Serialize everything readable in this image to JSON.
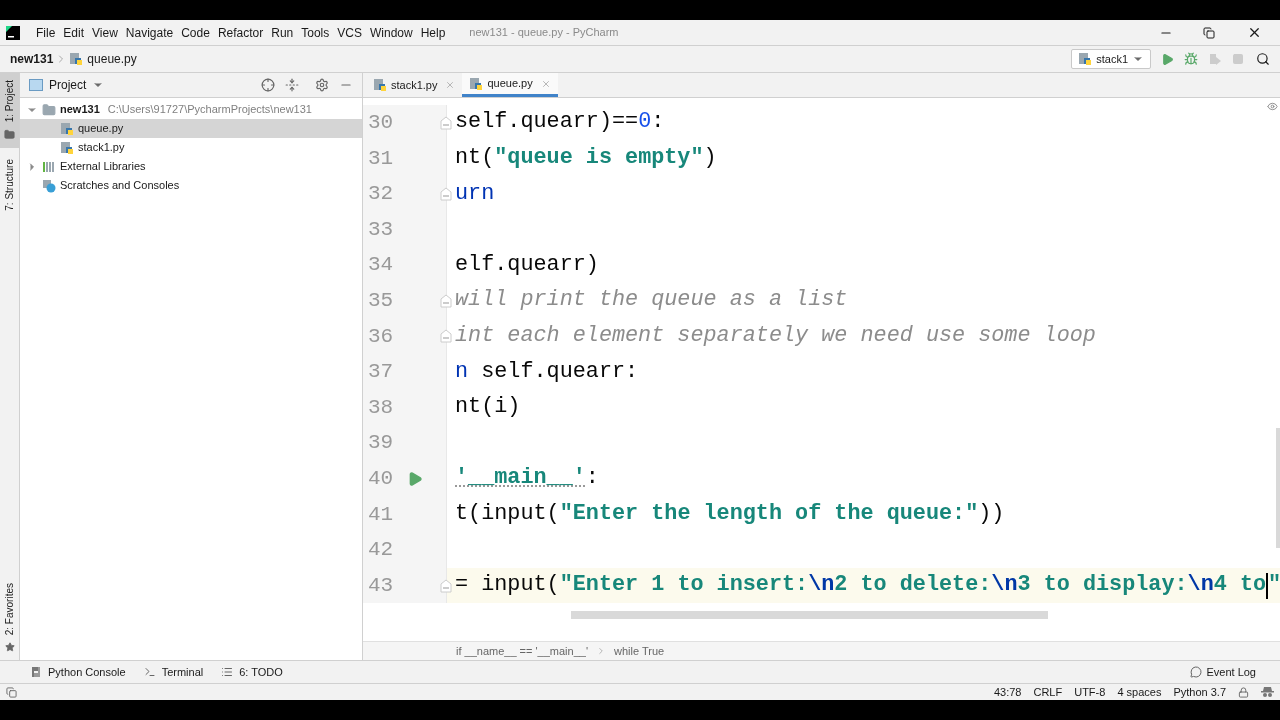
{
  "menu": {
    "items": [
      "File",
      "Edit",
      "View",
      "Navigate",
      "Code",
      "Refactor",
      "Run",
      "Tools",
      "VCS",
      "Window",
      "Help"
    ],
    "title": "new131 - queue.py - PyCharm"
  },
  "navbar": {
    "crumbs": [
      "new131",
      "queue.py"
    ],
    "run_config": "stack1"
  },
  "side_tabs": [
    "1: Project",
    "7: Structure",
    "2: Favorites"
  ],
  "project": {
    "title": "Project",
    "tree": [
      {
        "label": "new131",
        "path": "C:\\Users\\91727\\PycharmProjects\\new131",
        "kind": "folder",
        "expanded": true,
        "selected": false,
        "children": [
          {
            "label": "queue.py",
            "kind": "py",
            "selected": true
          },
          {
            "label": "stack1.py",
            "kind": "py",
            "selected": false
          }
        ]
      },
      {
        "label": "External Libraries",
        "kind": "lib",
        "expanded": false,
        "selected": false
      },
      {
        "label": "Scratches and Consoles",
        "kind": "scratch",
        "selected": false
      }
    ]
  },
  "tabs": [
    {
      "label": "stack1.py",
      "selected": false
    },
    {
      "label": "queue.py",
      "selected": true
    }
  ],
  "code": [
    {
      "number": "30",
      "fold": true,
      "run": false,
      "current": false,
      "tokens": [
        {
          "kind": "plain",
          "text": "self.quearr)=="
        },
        {
          "kind": "number",
          "text": "0"
        },
        {
          "kind": "plain",
          "text": ":"
        }
      ]
    },
    {
      "number": "31",
      "fold": false,
      "run": false,
      "current": false,
      "tokens": [
        {
          "kind": "plain",
          "text": "nt("
        },
        {
          "kind": "string",
          "text": "\"queue is empty\""
        },
        {
          "kind": "plain",
          "text": ")"
        }
      ]
    },
    {
      "number": "32",
      "fold": true,
      "run": false,
      "current": false,
      "tokens": [
        {
          "kind": "keyword",
          "text": "urn"
        }
      ]
    },
    {
      "number": "33",
      "fold": false,
      "run": false,
      "current": false
    },
    {
      "number": "34",
      "fold": false,
      "run": false,
      "current": false,
      "tokens": [
        {
          "kind": "plain",
          "text": "elf.quearr)"
        }
      ]
    },
    {
      "number": "35",
      "fold": true,
      "run": false,
      "current": false,
      "tokens": [
        {
          "kind": "comment",
          "text": "will print the queue as a list"
        }
      ]
    },
    {
      "number": "36",
      "fold": true,
      "run": false,
      "current": false,
      "tokens": [
        {
          "kind": "comment",
          "text": "int each element separately we need use some loop"
        }
      ]
    },
    {
      "number": "37",
      "fold": false,
      "run": false,
      "current": false,
      "tokens": [
        {
          "kind": "keyword",
          "text": "n"
        },
        {
          "kind": "plain",
          "text": " self.quearr:"
        }
      ]
    },
    {
      "number": "38",
      "fold": false,
      "run": false,
      "current": false,
      "tokens": [
        {
          "kind": "plain",
          "text": "nt(i)"
        }
      ]
    },
    {
      "number": "39",
      "fold": false,
      "run": false,
      "current": false
    },
    {
      "number": "40",
      "fold": false,
      "run": true,
      "current": false,
      "tokens": [
        {
          "kind": "string",
          "text": "'__main__'"
        },
        {
          "kind": "plain",
          "text": ":"
        }
      ]
    },
    {
      "number": "41",
      "fold": false,
      "run": false,
      "current": false,
      "tokens": [
        {
          "kind": "plain",
          "text": "t(input("
        },
        {
          "kind": "string",
          "text": "\"Enter the length of the queue:\""
        },
        {
          "kind": "plain",
          "text": "))"
        }
      ]
    },
    {
      "number": "42",
      "fold": false,
      "run": false,
      "current": false
    },
    {
      "number": "43",
      "fold": true,
      "run": false,
      "current": true,
      "tokens": [
        {
          "kind": "plain",
          "text": "= input("
        },
        {
          "kind": "string",
          "text": "\"Enter 1 to insert:"
        },
        {
          "kind": "escape",
          "text": "\\n"
        },
        {
          "kind": "string",
          "text": "2 to delete:"
        },
        {
          "kind": "escape",
          "text": "\\n"
        },
        {
          "kind": "string",
          "text": "3 to display:"
        },
        {
          "kind": "escape",
          "text": "\\n"
        },
        {
          "kind": "string",
          "text": "4 to"
        },
        {
          "kind": "string",
          "text": "\"",
          "caret_before": true
        }
      ]
    }
  ],
  "breadcrumbs": [
    "if __name__ == '__main__'",
    "while True"
  ],
  "tool_tabs": [
    {
      "label": "Python Console",
      "kind": "python"
    },
    {
      "label": "Terminal",
      "kind": "terminal"
    },
    {
      "label": "6: TODO",
      "kind": "todo"
    }
  ],
  "event_log": "Event Log",
  "status": [
    "43:78",
    "CRLF",
    "UTF-8",
    "4 spaces",
    "Python 3.7"
  ]
}
